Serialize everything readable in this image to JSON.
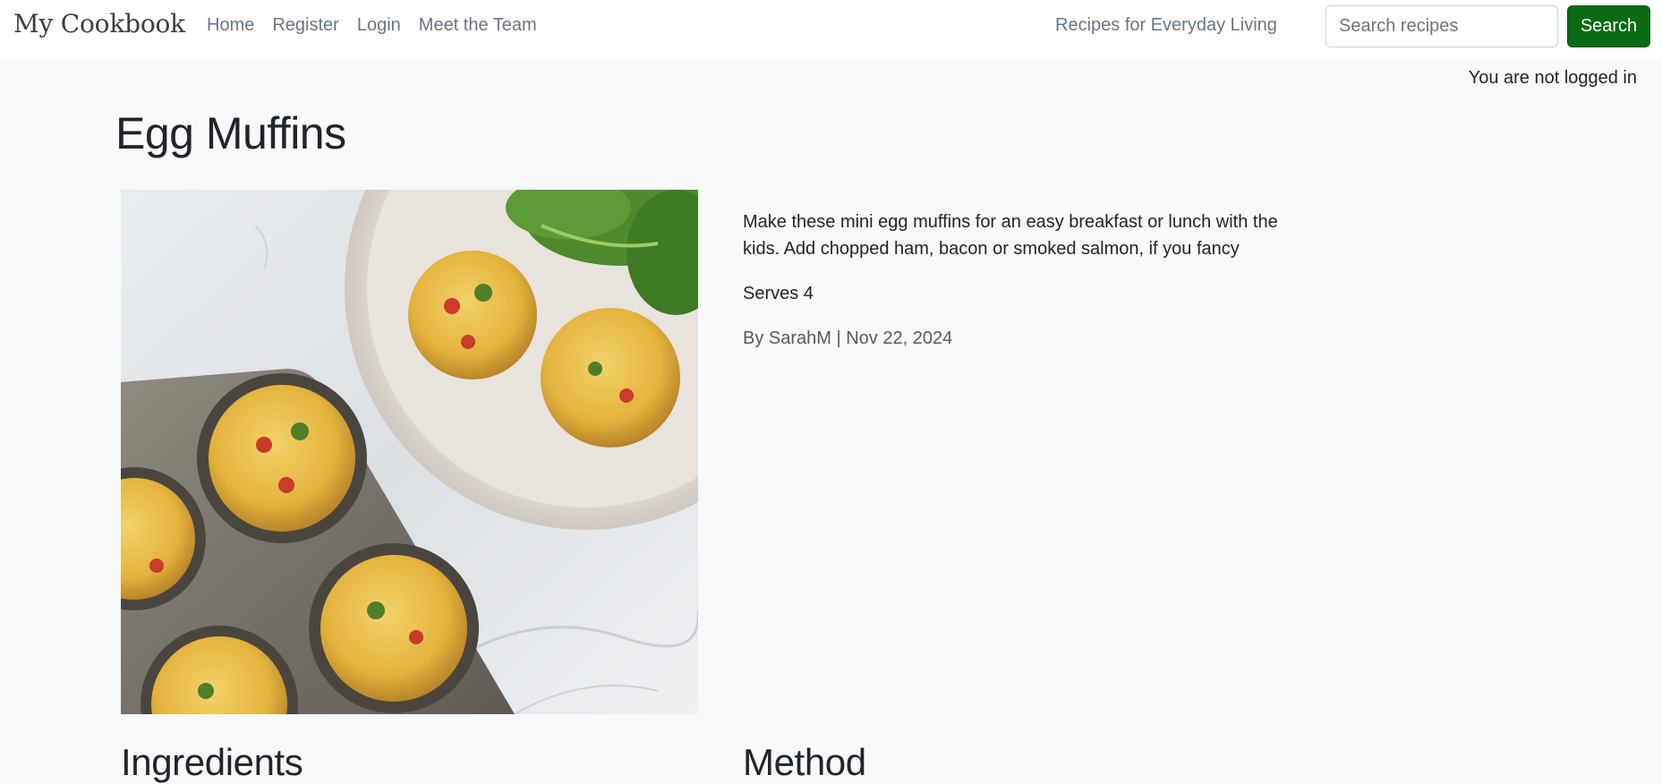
{
  "navbar": {
    "brand": "My Cookbook",
    "links": [
      {
        "label": "Home"
      },
      {
        "label": "Register"
      },
      {
        "label": "Login"
      },
      {
        "label": "Meet the Team"
      }
    ],
    "tagline": "Recipes for Everyday Living",
    "search": {
      "placeholder": "Search recipes",
      "value": "",
      "button_label": "Search"
    }
  },
  "auth": {
    "status": "You are not logged in"
  },
  "recipe": {
    "title": "Egg Muffins",
    "image_icon": "egg-muffins-photo",
    "description": "Make these mini egg muffins for an easy breakfast or lunch with the kids. Add chopped ham, bacon or smoked salmon, if you fancy",
    "serves": "Serves 4",
    "byline": "By SarahM | Nov 22, 2024"
  },
  "sections": {
    "ingredients": "Ingredients",
    "method": "Method"
  },
  "colors": {
    "search_button": "#0a6b14",
    "page_background": "#f8f9fa",
    "navbar_background": "#ffffff"
  }
}
